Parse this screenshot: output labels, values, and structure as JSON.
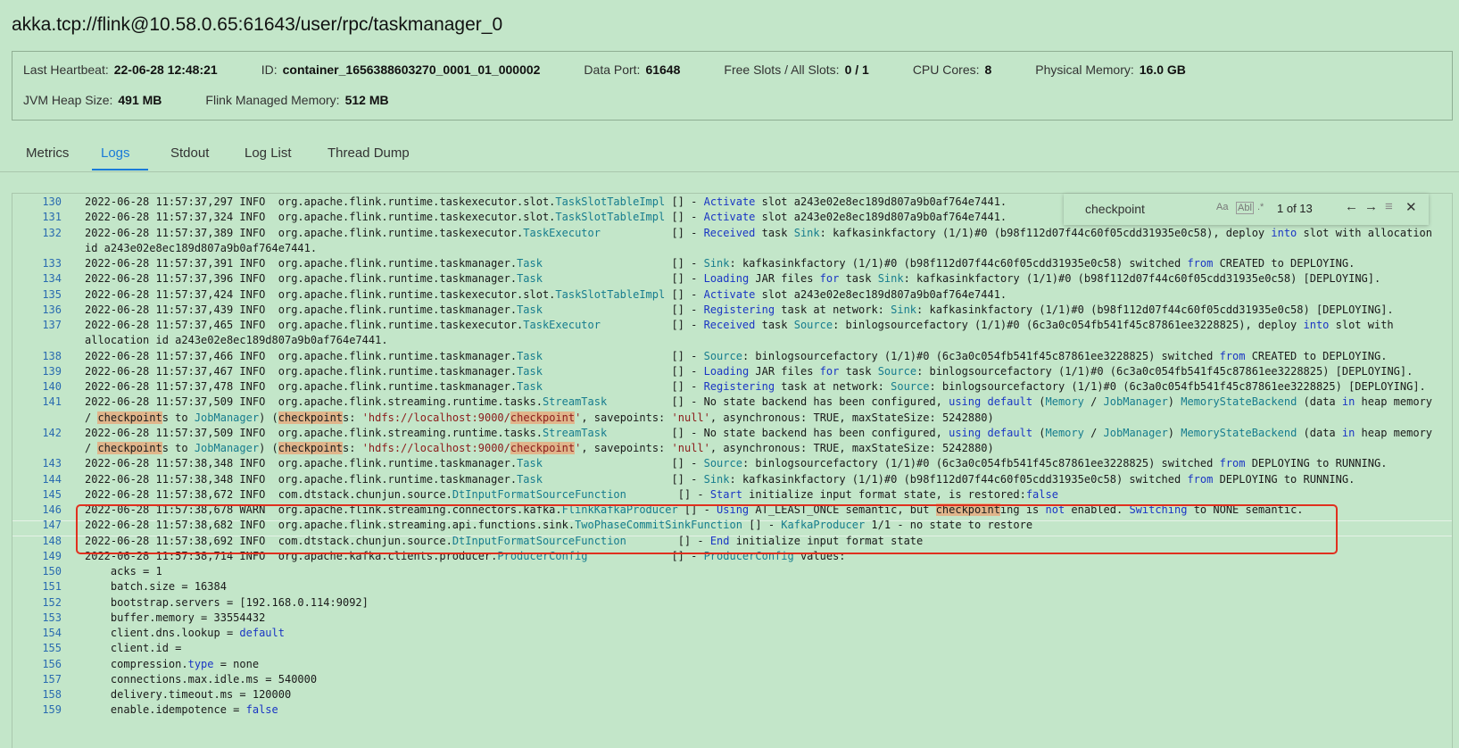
{
  "title": "akka.tcp://flink@10.58.0.65:61643/user/rpc/taskmanager_0",
  "info": {
    "row1": [
      {
        "label": "Last Heartbeat:",
        "value": "22-06-28 12:48:21"
      },
      {
        "label": "ID:",
        "value": "container_1656388603270_0001_01_000002"
      },
      {
        "label": "Data Port:",
        "value": "61648"
      },
      {
        "label": "Free Slots / All Slots:",
        "value": "0 / 1"
      },
      {
        "label": "CPU Cores:",
        "value": "8"
      },
      {
        "label": "Physical Memory:",
        "value": "16.0 GB"
      }
    ],
    "row2": [
      {
        "label": "JVM Heap Size:",
        "value": "491 MB"
      },
      {
        "label": "Flink Managed Memory:",
        "value": "512 MB"
      }
    ]
  },
  "tabs": [
    "Metrics",
    "Logs",
    "Stdout",
    "Log List",
    "Thread Dump"
  ],
  "active_tab": "Logs",
  "find": {
    "query": "checkpoint",
    "opt_case": "Aa",
    "opt_word": "Abl",
    "opt_regex": ".*",
    "count": "1 of 13",
    "prev": "←",
    "next": "→",
    "selection": "≡",
    "close": "✕"
  },
  "log": {
    "130": "2022-06-28 11:57:37,297 INFO  org.apache.flink.runtime.taskexecutor.slot.TaskSlotTableImpl [] - Activate slot a243e02e8ec189d807a9b0af764e7441.",
    "131": "2022-06-28 11:57:37,324 INFO  org.apache.flink.runtime.taskexecutor.slot.TaskSlotTableImpl [] - Activate slot a243e02e8ec189d807a9b0af764e7441.",
    "132": "2022-06-28 11:57:37,389 INFO  org.apache.flink.runtime.taskexecutor.TaskExecutor           [] - Received task Sink: kafkasinkfactory (1/1)#0 (b98f112d07f44c60f05cdd31935e0c58), deploy into slot with allocation",
    "132b": "id a243e02e8ec189d807a9b0af764e7441.",
    "133": "2022-06-28 11:57:37,391 INFO  org.apache.flink.runtime.taskmanager.Task                    [] - Sink: kafkasinkfactory (1/1)#0 (b98f112d07f44c60f05cdd31935e0c58) switched from CREATED to DEPLOYING.",
    "134": "2022-06-28 11:57:37,396 INFO  org.apache.flink.runtime.taskmanager.Task                    [] - Loading JAR files for task Sink: kafkasinkfactory (1/1)#0 (b98f112d07f44c60f05cdd31935e0c58) [DEPLOYING].",
    "135": "2022-06-28 11:57:37,424 INFO  org.apache.flink.runtime.taskexecutor.slot.TaskSlotTableImpl [] - Activate slot a243e02e8ec189d807a9b0af764e7441.",
    "136": "2022-06-28 11:57:37,439 INFO  org.apache.flink.runtime.taskmanager.Task                    [] - Registering task at network: Sink: kafkasinkfactory (1/1)#0 (b98f112d07f44c60f05cdd31935e0c58) [DEPLOYING].",
    "137": "2022-06-28 11:57:37,465 INFO  org.apache.flink.runtime.taskexecutor.TaskExecutor           [] - Received task Source: binlogsourcefactory (1/1)#0 (6c3a0c054fb541f45c87861ee3228825), deploy into slot with",
    "137b": "allocation id a243e02e8ec189d807a9b0af764e7441.",
    "138": "2022-06-28 11:57:37,466 INFO  org.apache.flink.runtime.taskmanager.Task                    [] - Source: binlogsourcefactory (1/1)#0 (6c3a0c054fb541f45c87861ee3228825) switched from CREATED to DEPLOYING.",
    "139": "2022-06-28 11:57:37,467 INFO  org.apache.flink.runtime.taskmanager.Task                    [] - Loading JAR files for task Source: binlogsourcefactory (1/1)#0 (6c3a0c054fb541f45c87861ee3228825) [DEPLOYING].",
    "140": "2022-06-28 11:57:37,478 INFO  org.apache.flink.runtime.taskmanager.Task                    [] - Registering task at network: Source: binlogsourcefactory (1/1)#0 (6c3a0c054fb541f45c87861ee3228825) [DEPLOYING].",
    "141": "2022-06-28 11:57:37,509 INFO  org.apache.flink.streaming.runtime.tasks.StreamTask          [] - No state backend has been configured, using default (Memory / JobManager) MemoryStateBackend (data in heap memory",
    "141b": "/ checkpoints to JobManager) (checkpoints: 'hdfs://localhost:9000/checkpoint', savepoints: 'null', asynchronous: TRUE, maxStateSize: 5242880)",
    "142": "2022-06-28 11:57:37,509 INFO  org.apache.flink.streaming.runtime.tasks.StreamTask          [] - No state backend has been configured, using default (Memory / JobManager) MemoryStateBackend (data in heap memory",
    "142b": "/ checkpoints to JobManager) (checkpoints: 'hdfs://localhost:9000/checkpoint', savepoints: 'null', asynchronous: TRUE, maxStateSize: 5242880)",
    "143": "2022-06-28 11:57:38,348 INFO  org.apache.flink.runtime.taskmanager.Task                    [] - Source: binlogsourcefactory (1/1)#0 (6c3a0c054fb541f45c87861ee3228825) switched from DEPLOYING to RUNNING.",
    "144": "2022-06-28 11:57:38,348 INFO  org.apache.flink.runtime.taskmanager.Task                    [] - Sink: kafkasinkfactory (1/1)#0 (b98f112d07f44c60f05cdd31935e0c58) switched from DEPLOYING to RUNNING.",
    "145": "2022-06-28 11:57:38,672 INFO  com.dtstack.chunjun.source.DtInputFormatSourceFunction        [] - Start initialize input format state, is restored:false",
    "146": "2022-06-28 11:57:38,678 WARN  org.apache.flink.streaming.connectors.kafka.FlinkKafkaProducer [] - Using AT_LEAST_ONCE semantic, but checkpointing is not enabled. Switching to NONE semantic.",
    "147": "2022-06-28 11:57:38,682 INFO  org.apache.flink.streaming.api.functions.sink.TwoPhaseCommitSinkFunction [] - KafkaProducer 1/1 - no state to restore",
    "148": "2022-06-28 11:57:38,692 INFO  com.dtstack.chunjun.source.DtInputFormatSourceFunction        [] - End initialize input format state",
    "149": "2022-06-28 11:57:38,714 INFO  org.apache.kafka.clients.producer.ProducerConfig             [] - ProducerConfig values:",
    "150": "    acks = 1",
    "151": "    batch.size = 16384",
    "152": "    bootstrap.servers = [192.168.0.114:9092]",
    "153": "    buffer.memory = 33554432",
    "154": "    client.dns.lookup = default",
    "155": "    client.id =",
    "156": "    compression.type = none",
    "157": "    connections.max.idle.ms = 540000",
    "158": "    delivery.timeout.ms = 120000",
    "159": "    enable.idempotence = false"
  },
  "line_numbers": [
    "130",
    "131",
    "132",
    "133",
    "134",
    "135",
    "136",
    "137",
    "138",
    "139",
    "140",
    "141",
    "142",
    "143",
    "144",
    "145",
    "146",
    "147",
    "148",
    "149",
    "150",
    "151",
    "152",
    "153",
    "154",
    "155",
    "156",
    "157",
    "158",
    "159"
  ]
}
